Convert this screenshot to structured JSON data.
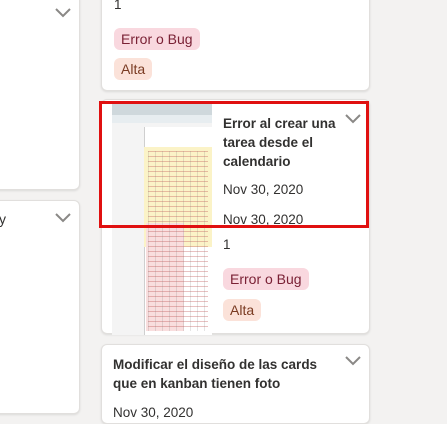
{
  "left_column": {
    "card_top": {
      "chevron": "chevron-down-icon"
    },
    "card_mid": {
      "fragment": "y",
      "chevron": "chevron-down-icon"
    }
  },
  "top_card": {
    "count": "1",
    "tags": [
      "Error o Bug",
      "Alta"
    ],
    "chevron": "chevron-down-icon"
  },
  "main_card": {
    "title": "Error al crear una tarea desde el calendario",
    "start_date": "Nov 30, 2020",
    "due_date": "Nov 30, 2020",
    "count": "1",
    "tags": [
      "Error o Bug",
      "Alta"
    ],
    "chevron": "chevron-down-icon",
    "thumbnail": "spreadsheet-screenshot-thumbnail"
  },
  "bottom_card": {
    "title": "Modificar el diseño de las cards que en kanban tienen foto",
    "date": "Nov 30, 2020",
    "chevron": "chevron-down-icon"
  },
  "colors": {
    "highlight": "#e01010",
    "tag_bug_bg": "#f9d8df",
    "tag_alta_bg": "#fbe2d9"
  }
}
